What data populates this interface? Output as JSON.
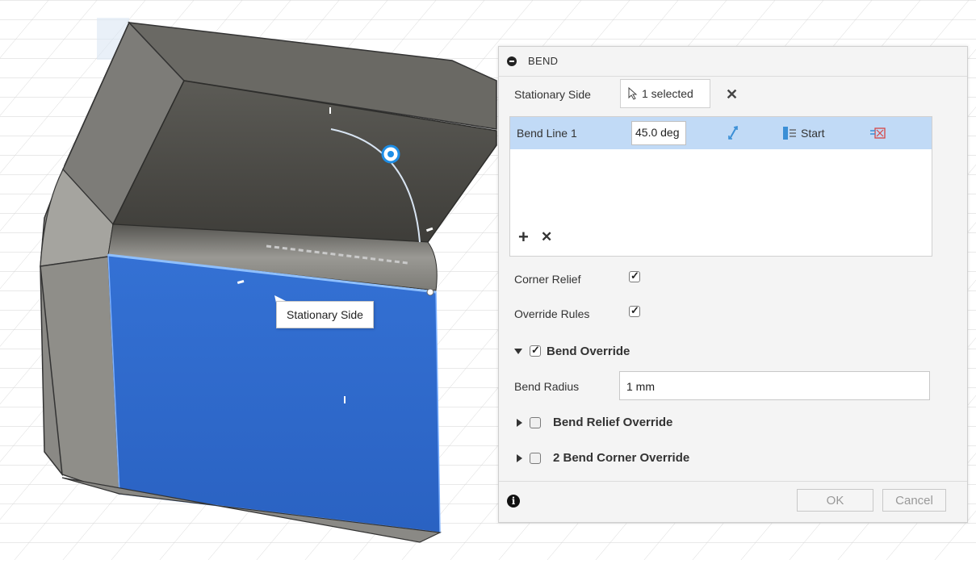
{
  "viewport": {
    "tooltip": "Stationary Side"
  },
  "dialog": {
    "title": "BEND",
    "stationary_side": {
      "label": "Stationary Side",
      "selection": "1 selected"
    },
    "bend_lines": [
      {
        "name": "Bend Line 1",
        "angle": "45.0 deg",
        "direction": "Start"
      }
    ],
    "corner_relief": {
      "label": "Corner Relief",
      "checked": true
    },
    "override_rules": {
      "label": "Override Rules",
      "checked": true
    },
    "bend_override": {
      "label": "Bend Override",
      "checked": true,
      "expanded": true,
      "radius_label": "Bend Radius",
      "radius_value": "1 mm"
    },
    "bend_relief_override": {
      "label": "Bend Relief Override",
      "checked": false
    },
    "bend_corner_override": {
      "label": "2 Bend Corner Override",
      "checked": false
    },
    "ok_label": "OK",
    "cancel_label": "Cancel"
  },
  "colors": {
    "selection_blue": "#2f6bd0",
    "row_highlight": "#c1daf6",
    "model_dark": "#4e4d48"
  }
}
